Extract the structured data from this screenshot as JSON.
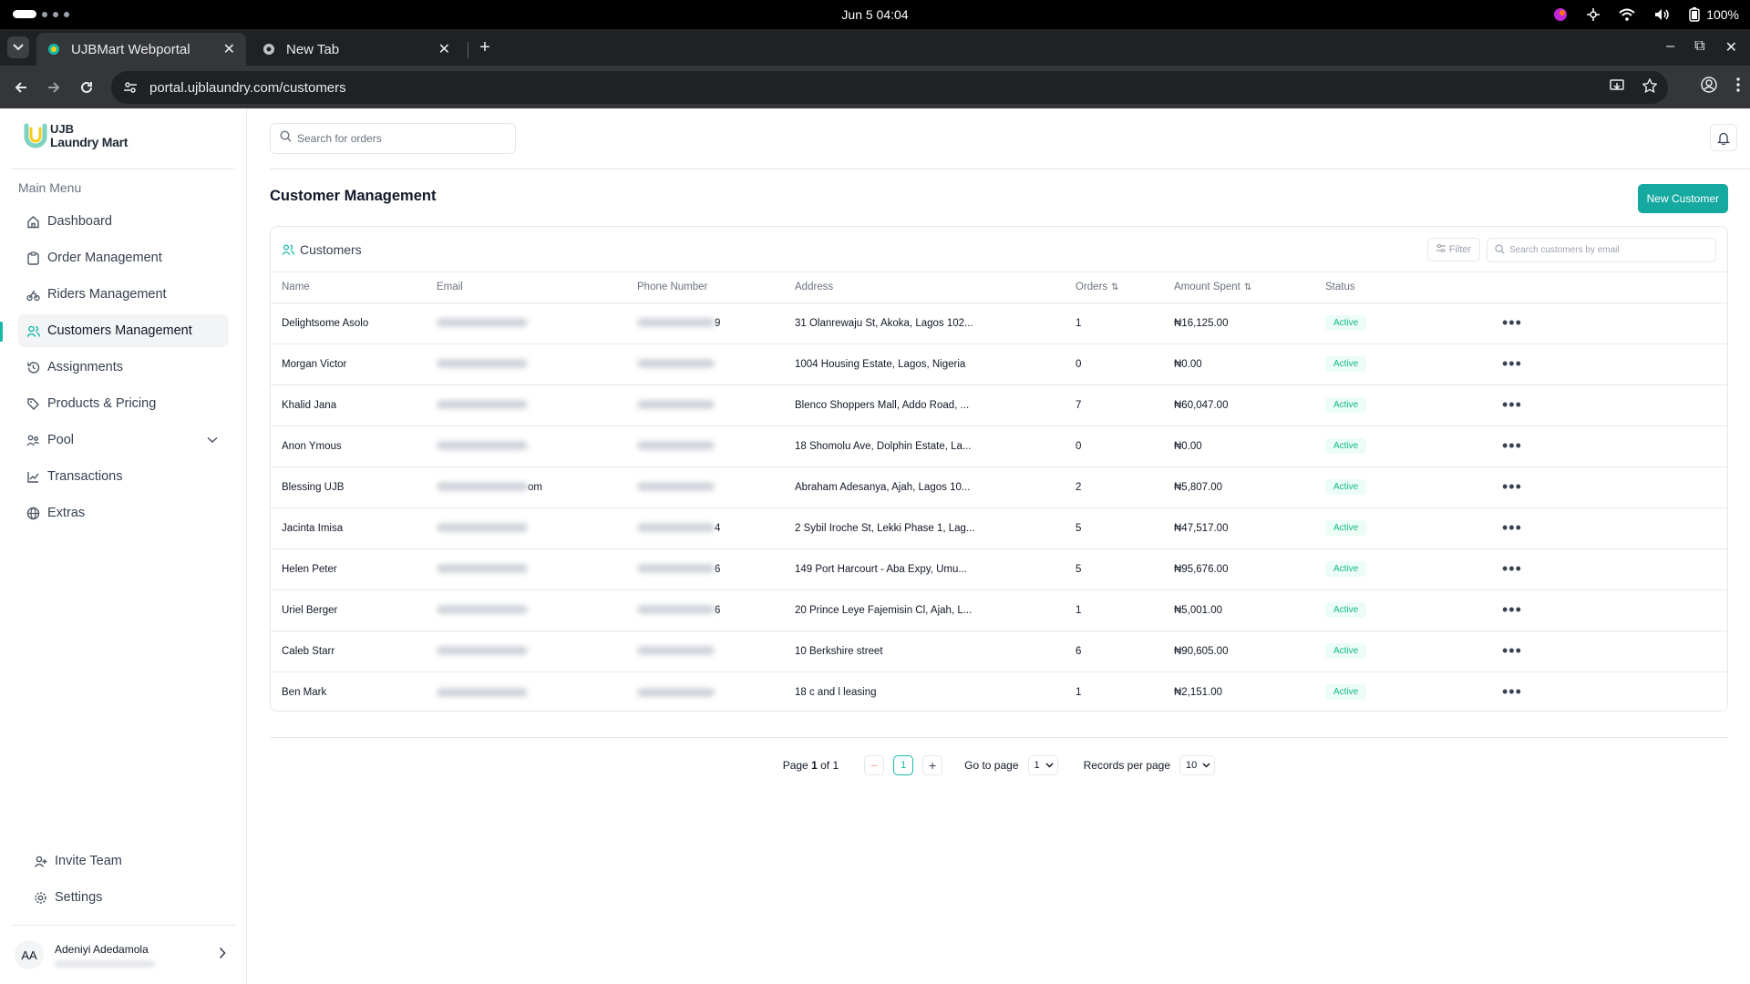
{
  "os": {
    "clock": "Jun 5  04:04",
    "battery": "100%"
  },
  "browser": {
    "tabs": [
      {
        "title": "UJBMart Webportal",
        "active": true
      },
      {
        "title": "New Tab",
        "active": false
      }
    ],
    "url": "portal.ujblaundry.com/customers"
  },
  "sidebar": {
    "brand_line1": "UJB",
    "brand_line2": "Laundry Mart",
    "menu_heading": "Main Menu",
    "items": [
      {
        "label": "Dashboard",
        "icon": "home-icon"
      },
      {
        "label": "Order Management",
        "icon": "clipboard-icon"
      },
      {
        "label": "Riders Management",
        "icon": "bike-icon"
      },
      {
        "label": "Customers Management",
        "icon": "users-icon",
        "active": true
      },
      {
        "label": "Assignments",
        "icon": "history-icon"
      },
      {
        "label": "Products & Pricing",
        "icon": "tags-icon"
      },
      {
        "label": "Pool",
        "icon": "pool-icon",
        "expandable": true
      },
      {
        "label": "Transactions",
        "icon": "chart-line-icon"
      },
      {
        "label": "Extras",
        "icon": "globe-icon"
      }
    ],
    "bottom_items": [
      {
        "label": "Invite Team",
        "icon": "user-plus-icon"
      },
      {
        "label": "Settings",
        "icon": "gear-icon"
      }
    ],
    "user": {
      "initials": "AA",
      "name": "Adeniyi Adedamola"
    }
  },
  "header": {
    "search_placeholder": "Search for orders"
  },
  "page": {
    "title": "Customer Management",
    "new_button": "New Customer"
  },
  "customers": {
    "card_title": "Customers",
    "filter_label": "Filter",
    "search_placeholder": "Search customers by email",
    "columns": {
      "name": "Name",
      "email": "Email",
      "phone": "Phone Number",
      "address": "Address",
      "orders": "Orders",
      "amount": "Amount Spent",
      "status": "Status"
    },
    "rows": [
      {
        "name": "Delightsome Asolo",
        "email_tail": "",
        "phone_tail": "9",
        "address": "31 Olanrewaju St, Akoka, Lagos 102...",
        "orders": "1",
        "amount": "₦16,125.00",
        "status": "Active"
      },
      {
        "name": "Morgan Victor",
        "email_tail": "",
        "phone_tail": "",
        "address": "1004 Housing Estate, Lagos, Nigeria",
        "orders": "0",
        "amount": "₦0.00",
        "status": "Active"
      },
      {
        "name": "Khalid Jana",
        "email_tail": "",
        "phone_tail": "",
        "address": "Blenco Shoppers Mall, Addo Road, ...",
        "orders": "7",
        "amount": "₦60,047.00",
        "status": "Active"
      },
      {
        "name": "Anon Ymous",
        "email_tail": "",
        "phone_tail": "",
        "address": "18 Shomolu Ave, Dolphin Estate, La...",
        "orders": "0",
        "amount": "₦0.00",
        "status": "Active"
      },
      {
        "name": "Blessing UJB",
        "email_tail": "om",
        "phone_tail": "",
        "address": "Abraham Adesanya, Ajah, Lagos 10...",
        "orders": "2",
        "amount": "₦5,807.00",
        "status": "Active"
      },
      {
        "name": "Jacinta Imisa",
        "email_tail": "",
        "phone_tail": "4",
        "address": "2 Sybil Iroche St, Lekki Phase 1, Lag...",
        "orders": "5",
        "amount": "₦47,517.00",
        "status": "Active"
      },
      {
        "name": "Helen Peter",
        "email_tail": "",
        "phone_tail": "6",
        "address": "149 Port Harcourt - Aba Expy, Umu...",
        "orders": "5",
        "amount": "₦95,676.00",
        "status": "Active"
      },
      {
        "name": "Uriel Berger",
        "email_tail": "",
        "phone_tail": "6",
        "address": "20 Prince Leye Fajemisin Cl, Ajah, L...",
        "orders": "1",
        "amount": "₦5,001.00",
        "status": "Active"
      },
      {
        "name": "Caleb Starr",
        "email_tail": "",
        "phone_tail": "",
        "address": "10 Berkshire street",
        "orders": "6",
        "amount": "₦90,605.00",
        "status": "Active"
      },
      {
        "name": "Ben Mark",
        "email_tail": "",
        "phone_tail": "",
        "address": "18 c and l leasing",
        "orders": "1",
        "amount": "₦2,151.00",
        "status": "Active"
      }
    ]
  },
  "pagination": {
    "page_prefix": "Page",
    "current": "1",
    "of_text": "of 1",
    "minus": "−",
    "plus": "+",
    "goto_label": "Go to page",
    "goto_value": "1",
    "records_label": "Records per page",
    "records_value": "10"
  },
  "colors": {
    "accent": "#16a9a0",
    "active_badge_bg": "#ecfdf5",
    "active_badge_text": "#10b981"
  }
}
